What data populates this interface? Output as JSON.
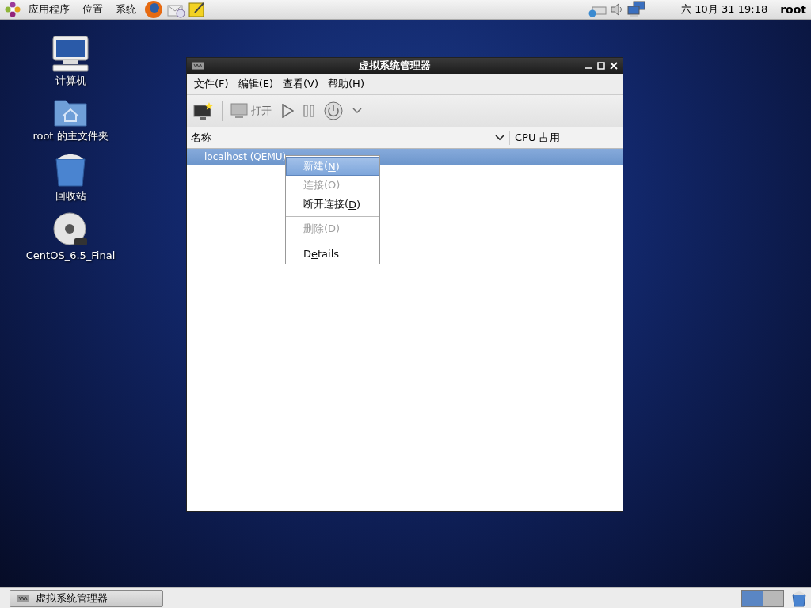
{
  "top_panel": {
    "menus": [
      "应用程序",
      "位置",
      "系统"
    ],
    "clock": "六 10月 31 19:18",
    "user": "root"
  },
  "desktop_icons": [
    {
      "kind": "computer",
      "label": "计算机"
    },
    {
      "kind": "home",
      "label": "root 的主文件夹"
    },
    {
      "kind": "trash",
      "label": "回收站"
    },
    {
      "kind": "dvd",
      "label": "CentOS_6.5_Final"
    }
  ],
  "window": {
    "title": "虚拟系统管理器",
    "menu": [
      "文件(F)",
      "编辑(E)",
      "查看(V)",
      "帮助(H)"
    ],
    "toolbar": [
      {
        "kind": "new",
        "disabled": false
      },
      {
        "kind": "separator"
      },
      {
        "kind": "open",
        "label": "打开",
        "disabled": true
      },
      {
        "kind": "play",
        "disabled": true
      },
      {
        "kind": "pause",
        "disabled": true
      },
      {
        "kind": "power",
        "disabled": true
      },
      {
        "kind": "caret",
        "disabled": true
      }
    ],
    "columns": [
      "名称",
      "CPU 占用"
    ],
    "rows": [
      {
        "name": "localhost (QEMU)",
        "selected": true
      }
    ]
  },
  "context_menu": [
    {
      "kind": "item",
      "before": "新建(",
      "mnemonic": "N",
      "after": ")",
      "selected": true,
      "disabled": false
    },
    {
      "kind": "item",
      "before": "连接(O)",
      "selected": false,
      "disabled": true
    },
    {
      "kind": "item",
      "before": "断开连接(",
      "mnemonic": "D",
      "after": ")",
      "selected": false,
      "disabled": false
    },
    {
      "kind": "separator"
    },
    {
      "kind": "item",
      "before": "删除(D)",
      "selected": false,
      "disabled": true
    },
    {
      "kind": "separator"
    },
    {
      "kind": "item",
      "before": "D",
      "mnemonic": "e",
      "after": "tails",
      "selected": false,
      "disabled": false
    }
  ],
  "taskbar": {
    "tasks": [
      {
        "title": "虚拟系统管理器"
      }
    ],
    "workspaces": [
      {
        "selected": true
      },
      {
        "selected": false
      }
    ]
  }
}
